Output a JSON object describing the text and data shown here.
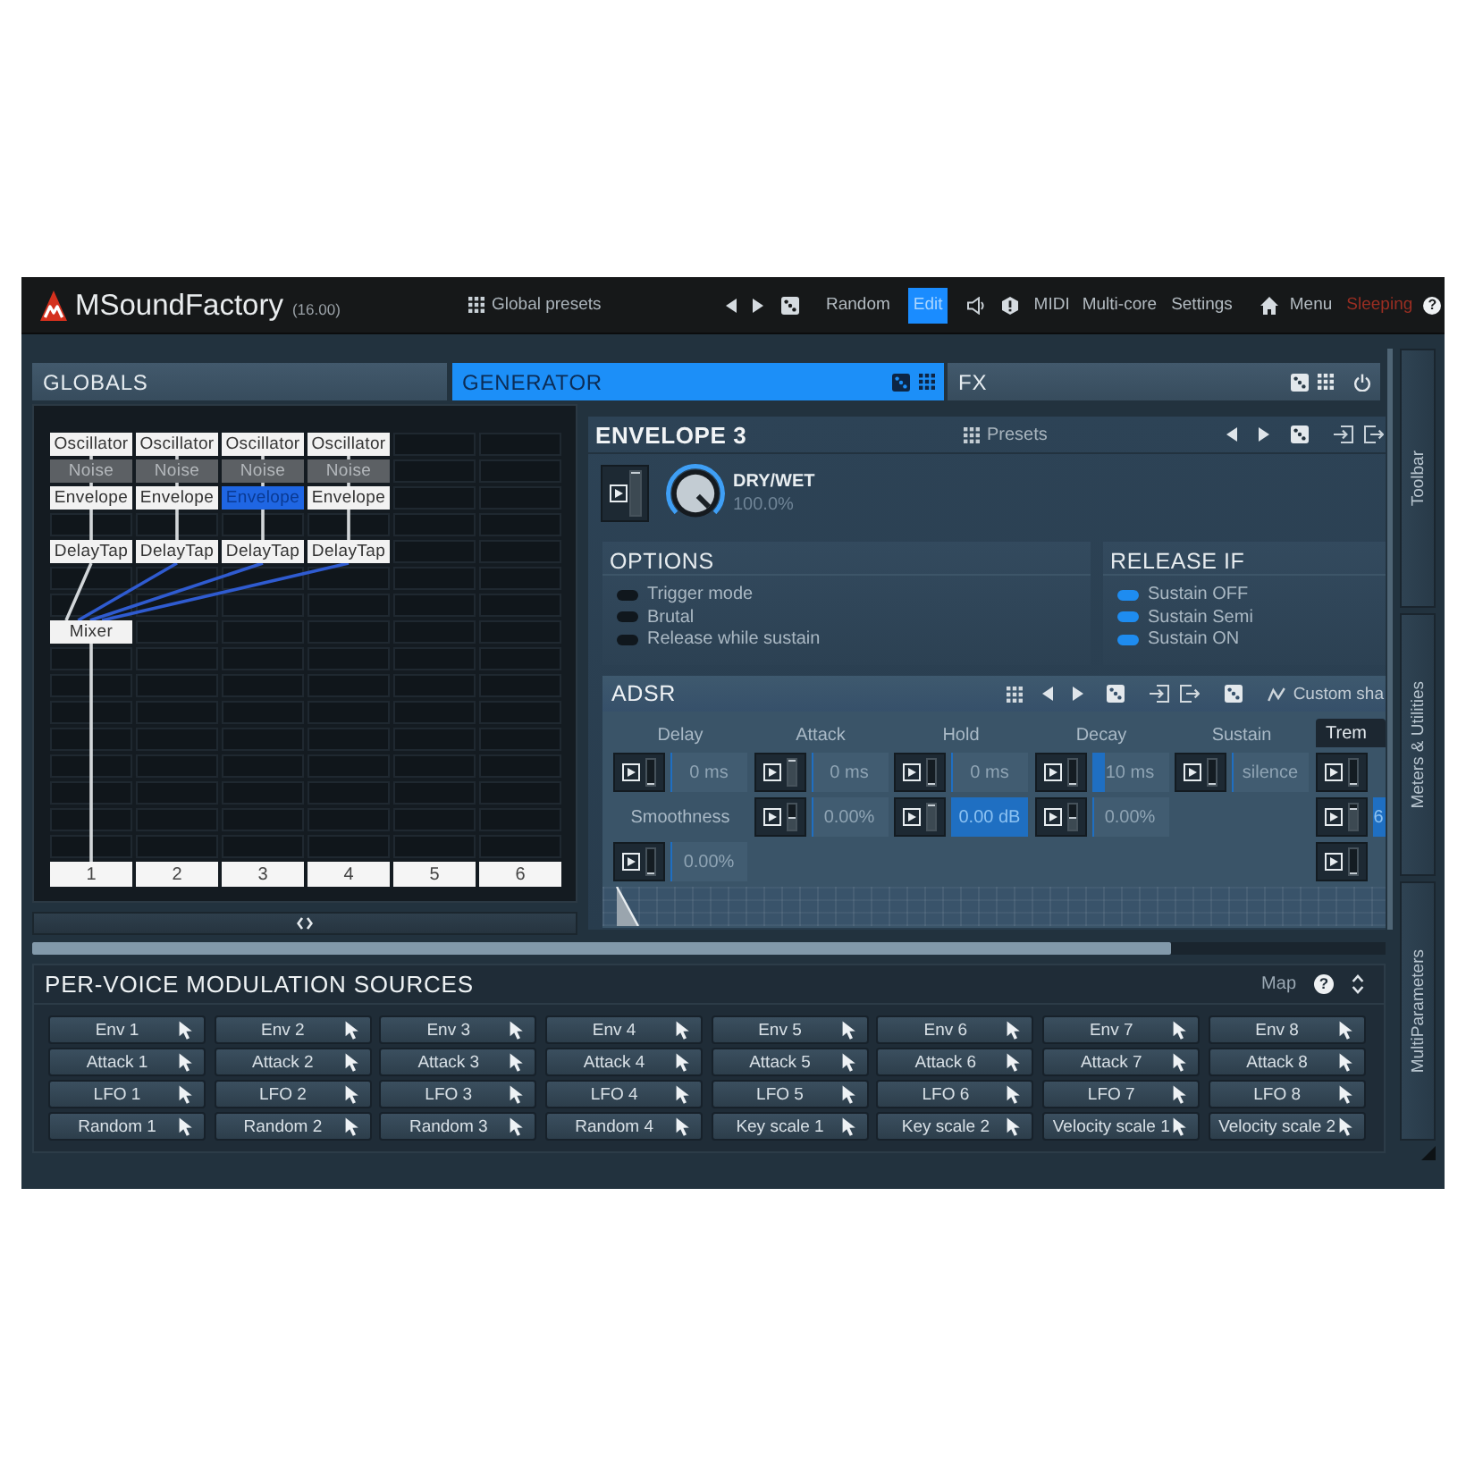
{
  "title_bar": {
    "app_name": "MSoundFactory",
    "version": "(16.00)",
    "global_presets": "Global presets",
    "random": "Random",
    "edit": {
      "label": "Edit",
      "selected": true
    },
    "midi": "MIDI",
    "multi_core": "Multi-core",
    "settings": "Settings",
    "menu": "Menu",
    "status": "Sleeping",
    "help": "?"
  },
  "sections": [
    {
      "label": "GLOBALS",
      "selected": false
    },
    {
      "label": "GENERATOR",
      "selected": true
    },
    {
      "label": "FX",
      "selected": false
    }
  ],
  "module_grid": {
    "rows": [
      [
        {
          "kind": "module",
          "label": "Oscillator",
          "selected": false,
          "disabled": false,
          "link": {
            "kind": "down",
            "color": "#d2d6d9"
          }
        },
        {
          "kind": "module",
          "label": "Oscillator",
          "selected": false,
          "disabled": false,
          "link": {
            "kind": "down",
            "color": "#d2d6d9"
          }
        },
        {
          "kind": "module",
          "label": "Oscillator",
          "selected": false,
          "disabled": false,
          "link": {
            "kind": "down",
            "color": "#d2d6d9"
          }
        },
        {
          "kind": "module",
          "label": "Oscillator",
          "selected": false,
          "disabled": false,
          "link": {
            "kind": "down",
            "color": "#d2d6d9"
          }
        },
        {
          "kind": "empty"
        },
        {
          "kind": "empty"
        }
      ],
      [
        {
          "kind": "module",
          "label": "Noise",
          "selected": false,
          "disabled": true
        },
        {
          "kind": "module",
          "label": "Noise",
          "selected": false,
          "disabled": true
        },
        {
          "kind": "module",
          "label": "Noise",
          "selected": false,
          "disabled": true
        },
        {
          "kind": "module",
          "label": "Noise",
          "selected": false,
          "disabled": true
        },
        {
          "kind": "empty"
        },
        {
          "kind": "empty"
        }
      ],
      [
        {
          "kind": "module",
          "label": "Envelope",
          "selected": false,
          "disabled": false,
          "link": {
            "kind": "down",
            "color": "#d2d6d9"
          }
        },
        {
          "kind": "module",
          "label": "Envelope",
          "selected": false,
          "disabled": false,
          "link": {
            "kind": "down",
            "color": "#d2d6d9"
          }
        },
        {
          "kind": "module",
          "label": "Envelope",
          "selected": true,
          "disabled": false,
          "link": {
            "kind": "down",
            "color": "#d2d6d9"
          }
        },
        {
          "kind": "module",
          "label": "Envelope",
          "selected": false,
          "disabled": false,
          "link": {
            "kind": "down",
            "color": "#d2d6d9"
          }
        },
        {
          "kind": "empty"
        },
        {
          "kind": "empty"
        }
      ],
      [
        {
          "kind": "empty"
        },
        {
          "kind": "empty"
        },
        {
          "kind": "empty"
        },
        {
          "kind": "empty"
        },
        {
          "kind": "empty"
        },
        {
          "kind": "empty"
        }
      ],
      [
        {
          "kind": "module",
          "label": "DelayTap",
          "selected": false,
          "disabled": false,
          "link": {
            "kind": "mixer",
            "color": "#d2d6d9"
          }
        },
        {
          "kind": "module",
          "label": "DelayTap",
          "selected": false,
          "disabled": false,
          "link": {
            "kind": "mixer",
            "color": "#2f5bd0"
          }
        },
        {
          "kind": "module",
          "label": "DelayTap",
          "selected": false,
          "disabled": false,
          "link": {
            "kind": "mixer",
            "color": "#2f5bd0"
          }
        },
        {
          "kind": "module",
          "label": "DelayTap",
          "selected": false,
          "disabled": false,
          "link": {
            "kind": "mixer",
            "color": "#2f5bd0"
          }
        },
        {
          "kind": "empty"
        },
        {
          "kind": "empty"
        }
      ],
      [
        {
          "kind": "empty"
        },
        {
          "kind": "empty"
        },
        {
          "kind": "empty"
        },
        {
          "kind": "empty"
        },
        {
          "kind": "empty"
        },
        {
          "kind": "empty"
        }
      ],
      [
        {
          "kind": "empty"
        },
        {
          "kind": "empty"
        },
        {
          "kind": "empty"
        },
        {
          "kind": "empty"
        },
        {
          "kind": "empty"
        },
        {
          "kind": "empty"
        }
      ],
      [
        {
          "kind": "mixer",
          "label": "Mixer",
          "selected": false,
          "disabled": false,
          "link": {
            "kind": "output",
            "color": "#d2d6d9"
          }
        },
        {
          "kind": "empty"
        },
        {
          "kind": "empty"
        },
        {
          "kind": "empty"
        },
        {
          "kind": "empty"
        },
        {
          "kind": "empty"
        }
      ],
      [
        {
          "kind": "empty"
        },
        {
          "kind": "empty"
        },
        {
          "kind": "empty"
        },
        {
          "kind": "empty"
        },
        {
          "kind": "empty"
        },
        {
          "kind": "empty"
        }
      ],
      [
        {
          "kind": "empty"
        },
        {
          "kind": "empty"
        },
        {
          "kind": "empty"
        },
        {
          "kind": "empty"
        },
        {
          "kind": "empty"
        },
        {
          "kind": "empty"
        }
      ],
      [
        {
          "kind": "empty"
        },
        {
          "kind": "empty"
        },
        {
          "kind": "empty"
        },
        {
          "kind": "empty"
        },
        {
          "kind": "empty"
        },
        {
          "kind": "empty"
        }
      ],
      [
        {
          "kind": "empty"
        },
        {
          "kind": "empty"
        },
        {
          "kind": "empty"
        },
        {
          "kind": "empty"
        },
        {
          "kind": "empty"
        },
        {
          "kind": "empty"
        }
      ],
      [
        {
          "kind": "empty"
        },
        {
          "kind": "empty"
        },
        {
          "kind": "empty"
        },
        {
          "kind": "empty"
        },
        {
          "kind": "empty"
        },
        {
          "kind": "empty"
        }
      ],
      [
        {
          "kind": "empty"
        },
        {
          "kind": "empty"
        },
        {
          "kind": "empty"
        },
        {
          "kind": "empty"
        },
        {
          "kind": "empty"
        },
        {
          "kind": "empty"
        }
      ],
      [
        {
          "kind": "empty"
        },
        {
          "kind": "empty"
        },
        {
          "kind": "empty"
        },
        {
          "kind": "empty"
        },
        {
          "kind": "empty"
        },
        {
          "kind": "empty"
        }
      ],
      [
        {
          "kind": "empty"
        },
        {
          "kind": "empty"
        },
        {
          "kind": "empty"
        },
        {
          "kind": "empty"
        },
        {
          "kind": "empty"
        },
        {
          "kind": "empty"
        }
      ]
    ],
    "column_numbers": [
      "1",
      "2",
      "3",
      "4",
      "5",
      "6"
    ]
  },
  "envelope_panel": {
    "title": "ENVELOPE 3",
    "presets": "Presets",
    "dry_wet": {
      "label": "DRY/WET",
      "value": "100.0%",
      "level": 1,
      "mod": {
        "level": 1
      }
    },
    "options": {
      "title": "OPTIONS",
      "items": [
        {
          "label": "Trigger mode",
          "on": false
        },
        {
          "label": "Brutal",
          "on": false
        },
        {
          "label": "Release while sustain",
          "on": false
        }
      ]
    },
    "release_if": {
      "title": "RELEASE IF",
      "items": [
        {
          "label": "Sustain OFF",
          "on": true
        },
        {
          "label": "Sustain Semi",
          "on": true
        },
        {
          "label": "Sustain ON",
          "on": true
        }
      ]
    },
    "adsr": {
      "title": "ADSR",
      "shape": "Custom sha",
      "columns": [
        {
          "kind": "heading",
          "label": "Delay",
          "items": [
            {
              "kind": "control",
              "value": "0 ms",
              "level": 0,
              "mod": {
                "level": 0
              }
            },
            {
              "kind": "label",
              "label": "Smoothness"
            },
            {
              "kind": "control",
              "value": "0.00%",
              "level": 0,
              "mod": {
                "level": 0
              }
            }
          ]
        },
        {
          "kind": "heading",
          "label": "Attack",
          "items": [
            {
              "kind": "control",
              "value": "0 ms",
              "level": 0,
              "mod": {
                "level": 1
              }
            },
            {
              "kind": "control",
              "value": "0.00%",
              "level": 0,
              "mod": {
                "level": 0.5
              }
            }
          ]
        },
        {
          "kind": "heading",
          "label": "Hold",
          "items": [
            {
              "kind": "control",
              "value": "0 ms",
              "level": 0,
              "mod": {
                "level": 0
              }
            },
            {
              "kind": "control",
              "value": "0.00 dB",
              "level": 1,
              "mod": {
                "level": 1
              }
            }
          ]
        },
        {
          "kind": "heading",
          "label": "Decay",
          "items": [
            {
              "kind": "control",
              "value": "10 ms",
              "level": 0.17,
              "mod": {
                "level": 0
              }
            },
            {
              "kind": "control",
              "value": "0.00%",
              "level": 0,
              "mod": {
                "level": 0.5
              }
            }
          ]
        },
        {
          "kind": "heading",
          "label": "Sustain",
          "items": [
            {
              "kind": "control",
              "value": "silence",
              "level": 0,
              "mod": {
                "level": 0
              }
            }
          ]
        },
        {
          "kind": "tab",
          "label": "Trem",
          "items": [
            {
              "kind": "control",
              "mod": {
                "level": 0
              }
            },
            {
              "kind": "control",
              "value": "6",
              "level": 1,
              "mod": {
                "level": 0.85
              }
            },
            {
              "kind": "control",
              "mod": {
                "level": 0
              }
            }
          ]
        }
      ]
    }
  },
  "modulation_sources": {
    "title": "PER-VOICE MODULATION SOURCES",
    "map": "Map",
    "help": "?",
    "sources": [
      "Env 1",
      "Env 2",
      "Env 3",
      "Env 4",
      "Env 5",
      "Env 6",
      "Env 7",
      "Env 8",
      "Attack 1",
      "Attack 2",
      "Attack 3",
      "Attack 4",
      "Attack 5",
      "Attack 6",
      "Attack 7",
      "Attack 8",
      "LFO 1",
      "LFO 2",
      "LFO 3",
      "LFO 4",
      "LFO 5",
      "LFO 6",
      "LFO 7",
      "LFO 8",
      "Random 1",
      "Random 2",
      "Random 3",
      "Random 4",
      "Key scale 1",
      "Key scale 2",
      "Velocity scale 1",
      "Velocity scale 2"
    ]
  },
  "sidebar": {
    "tabs": [
      "Toolbar",
      "Meters & Utilities",
      "MultiParameters"
    ]
  }
}
